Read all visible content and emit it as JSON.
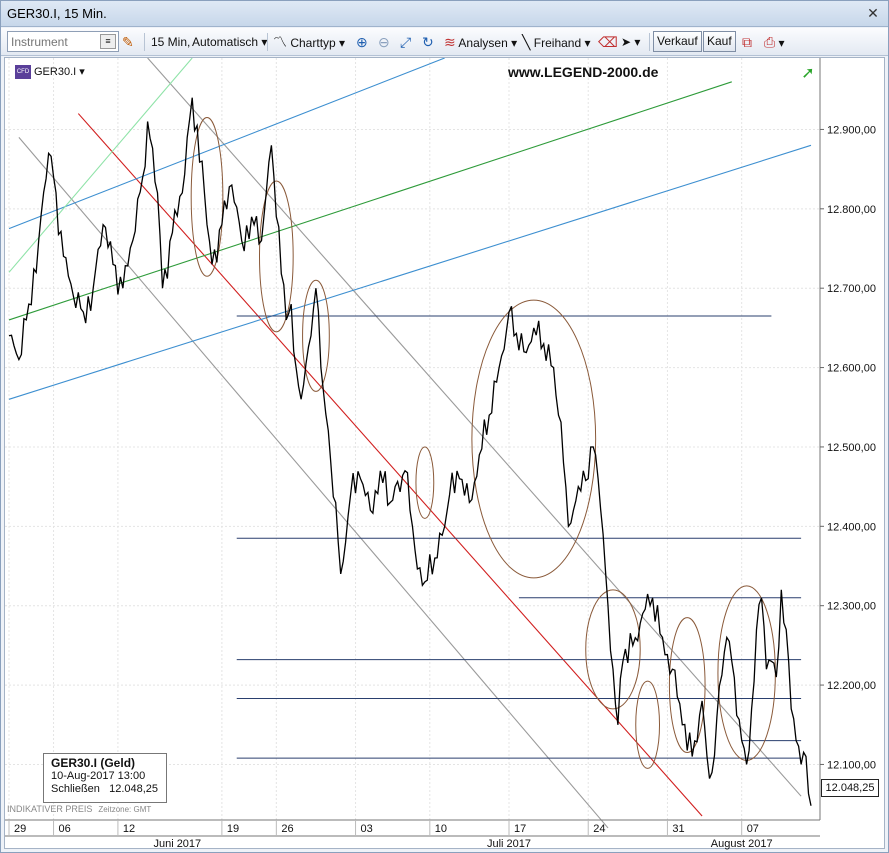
{
  "window": {
    "title": "GER30.I, 15 Min.",
    "close_glyph": "✕"
  },
  "toolbar": {
    "instrument_placeholder": "Instrument",
    "interval_label": "15 Min,",
    "scale_label": "Automatisch",
    "charttype_label": "Charttyp",
    "analysen_label": "Analysen",
    "freihand_label": "Freihand",
    "verkauf_label": "Verkauf",
    "kauf_label": "Kauf",
    "icons": [
      "list-icon",
      "chart-style-icon",
      "zoom-in-icon",
      "zoom-out-icon",
      "fit-icon",
      "refresh-icon",
      "analysis-icon",
      "draw-line-icon",
      "eraser-icon",
      "cursor-icon",
      "compare-icon",
      "print-icon"
    ]
  },
  "chart_header": {
    "symbol": "GER30.I",
    "watermark": "www.LEGEND-2000.de"
  },
  "infobox": {
    "title": "GER30.I (Geld)",
    "datetime": "10-Aug-2017 13:00",
    "close_label": "Schließen",
    "close_value": "12.048,25"
  },
  "footer": {
    "indicative": "INDIKATIVER PREIS",
    "timezone": "Zeitzone: GMT"
  },
  "last_price_label": "12.048,25",
  "colors": {
    "price": "#000000",
    "red_trend": "#d11e1e",
    "gray_channel": "#9a9a9a",
    "blue_channel": "#3d8fd0",
    "green_channel": "#2e9b3a",
    "light_green": "#8fe3a8",
    "horizontal": "#2a3f6e",
    "ellipse": "#8a5a3a",
    "up_arrow": "#2aa52a"
  },
  "chart_data": {
    "type": "line",
    "title": "GER30.I, 15 Min.",
    "series": [
      {
        "values": [
          [
            0,
            12640
          ],
          [
            2,
            12610
          ],
          [
            4,
            12680
          ],
          [
            6,
            12760
          ],
          [
            8,
            12870
          ],
          [
            9,
            12840
          ],
          [
            11,
            12740
          ],
          [
            13,
            12690
          ],
          [
            15,
            12670
          ],
          [
            17,
            12700
          ],
          [
            19,
            12780
          ],
          [
            21,
            12730
          ],
          [
            23,
            12700
          ],
          [
            25,
            12760
          ],
          [
            27,
            12840
          ],
          [
            28,
            12910
          ],
          [
            30,
            12820
          ],
          [
            31,
            12700
          ],
          [
            33,
            12770
          ],
          [
            35,
            12820
          ],
          [
            37,
            12940
          ],
          [
            39,
            12860
          ],
          [
            40,
            12780
          ],
          [
            41,
            12730
          ],
          [
            43,
            12780
          ],
          [
            45,
            12830
          ],
          [
            47,
            12760
          ],
          [
            49,
            12790
          ],
          [
            51,
            12760
          ],
          [
            53,
            12880
          ],
          [
            54,
            12790
          ],
          [
            56,
            12660
          ],
          [
            57,
            12680
          ],
          [
            58,
            12600
          ],
          [
            59,
            12560
          ],
          [
            61,
            12640
          ],
          [
            62,
            12700
          ],
          [
            63,
            12600
          ],
          [
            65,
            12480
          ],
          [
            66,
            12430
          ],
          [
            67,
            12340
          ],
          [
            68,
            12380
          ],
          [
            69,
            12440
          ],
          [
            71,
            12460
          ],
          [
            73,
            12420
          ],
          [
            75,
            12470
          ],
          [
            77,
            12430
          ],
          [
            78,
            12450
          ],
          [
            80,
            12470
          ],
          [
            81,
            12420
          ],
          [
            82,
            12370
          ],
          [
            84,
            12330
          ],
          [
            86,
            12360
          ],
          [
            88,
            12400
          ],
          [
            89,
            12440
          ],
          [
            91,
            12460
          ],
          [
            93,
            12430
          ],
          [
            95,
            12490
          ],
          [
            97,
            12540
          ],
          [
            99,
            12600
          ],
          [
            101,
            12670
          ],
          [
            102,
            12640
          ],
          [
            104,
            12620
          ],
          [
            106,
            12650
          ],
          [
            108,
            12630
          ],
          [
            110,
            12600
          ],
          [
            111,
            12540
          ],
          [
            112,
            12480
          ],
          [
            113,
            12400
          ],
          [
            114,
            12420
          ],
          [
            115,
            12450
          ],
          [
            116,
            12470
          ],
          [
            117,
            12460
          ],
          [
            118,
            12500
          ],
          [
            119,
            12460
          ],
          [
            120,
            12390
          ],
          [
            121,
            12300
          ],
          [
            122,
            12220
          ],
          [
            123,
            12150
          ],
          [
            124,
            12230
          ],
          [
            126,
            12250
          ],
          [
            128,
            12290
          ],
          [
            130,
            12310
          ],
          [
            132,
            12260
          ],
          [
            134,
            12220
          ],
          [
            136,
            12150
          ],
          [
            138,
            12110
          ],
          [
            140,
            12180
          ],
          [
            141,
            12110
          ],
          [
            142,
            12090
          ],
          [
            143,
            12160
          ],
          [
            145,
            12260
          ],
          [
            146,
            12230
          ],
          [
            148,
            12130
          ],
          [
            149,
            12100
          ],
          [
            150,
            12170
          ],
          [
            151,
            12270
          ],
          [
            152,
            12310
          ],
          [
            153,
            12220
          ],
          [
            154,
            12230
          ],
          [
            155,
            12210
          ],
          [
            156,
            12320
          ],
          [
            157,
            12270
          ],
          [
            158,
            12170
          ],
          [
            159,
            12130
          ],
          [
            160,
            12100
          ],
          [
            161,
            12110
          ],
          [
            162,
            12048
          ]
        ]
      }
    ],
    "y_ticks": [
      "12.100,00",
      "12.200,00",
      "12.300,00",
      "12.400,00",
      "12.500,00",
      "12.600,00",
      "12.700,00",
      "12.800,00",
      "12.900,00"
    ],
    "y_tick_values": [
      12100,
      12200,
      12300,
      12400,
      12500,
      12600,
      12700,
      12800,
      12900
    ],
    "ylim": [
      12030,
      12990
    ],
    "xlim": [
      0,
      162
    ],
    "x_ticks": [
      {
        "label": "29",
        "x": 0
      },
      {
        "label": "06",
        "x": 9
      },
      {
        "label": "12",
        "x": 22
      },
      {
        "label": "19",
        "x": 43
      },
      {
        "label": "26",
        "x": 54
      },
      {
        "label": "03",
        "x": 70
      },
      {
        "label": "10",
        "x": 85
      },
      {
        "label": "17",
        "x": 101
      },
      {
        "label": "24",
        "x": 117
      },
      {
        "label": "31",
        "x": 133
      },
      {
        "label": "07",
        "x": 148
      }
    ],
    "months": [
      {
        "label": "Juni 2017",
        "x": 34
      },
      {
        "label": "Juli 2017",
        "x": 101
      },
      {
        "label": "August 2017",
        "x": 148
      }
    ],
    "grid": true,
    "horizontal_levels": [
      {
        "value": 12665,
        "x0": 46,
        "x1": 154
      },
      {
        "value": 12385,
        "x0": 46,
        "x1": 160
      },
      {
        "value": 12310,
        "x0": 103,
        "x1": 160
      },
      {
        "value": 12232,
        "x0": 46,
        "x1": 160
      },
      {
        "value": 12183,
        "x0": 46,
        "x1": 160
      },
      {
        "value": 12130,
        "x0": 148,
        "x1": 160
      },
      {
        "value": 12108,
        "x0": 46,
        "x1": 160
      }
    ],
    "trend_lines": [
      {
        "kind": "red",
        "from": [
          14,
          12920
        ],
        "to": [
          140,
          12035
        ]
      },
      {
        "kind": "gray",
        "from": [
          2,
          12890
        ],
        "to": [
          121,
          12020
        ]
      },
      {
        "kind": "gray",
        "from": [
          28,
          12990
        ],
        "to": [
          160,
          12060
        ]
      },
      {
        "kind": "blue",
        "from": [
          0,
          12775
        ],
        "to": [
          88,
          12990
        ]
      },
      {
        "kind": "blue",
        "from": [
          0,
          12560
        ],
        "to": [
          162,
          12880
        ]
      },
      {
        "kind": "green",
        "from": [
          0,
          12660
        ],
        "to": [
          146,
          12960
        ]
      },
      {
        "kind": "lightgreen",
        "from": [
          0,
          12720
        ],
        "to": [
          37,
          12990
        ]
      }
    ],
    "ellipses": [
      {
        "cx": 40,
        "cy": 12815,
        "rx": 3.2,
        "ry": 100
      },
      {
        "cx": 54,
        "cy": 12740,
        "rx": 3.4,
        "ry": 95
      },
      {
        "cx": 62,
        "cy": 12640,
        "rx": 2.7,
        "ry": 70
      },
      {
        "cx": 84,
        "cy": 12455,
        "rx": 1.8,
        "ry": 45
      },
      {
        "cx": 106,
        "cy": 12510,
        "rx": 12.5,
        "ry": 175
      },
      {
        "cx": 122,
        "cy": 12245,
        "rx": 5.5,
        "ry": 75
      },
      {
        "cx": 129,
        "cy": 12150,
        "rx": 2.4,
        "ry": 55
      },
      {
        "cx": 137,
        "cy": 12200,
        "rx": 3.6,
        "ry": 85
      },
      {
        "cx": 149,
        "cy": 12215,
        "rx": 5.8,
        "ry": 110
      }
    ]
  }
}
